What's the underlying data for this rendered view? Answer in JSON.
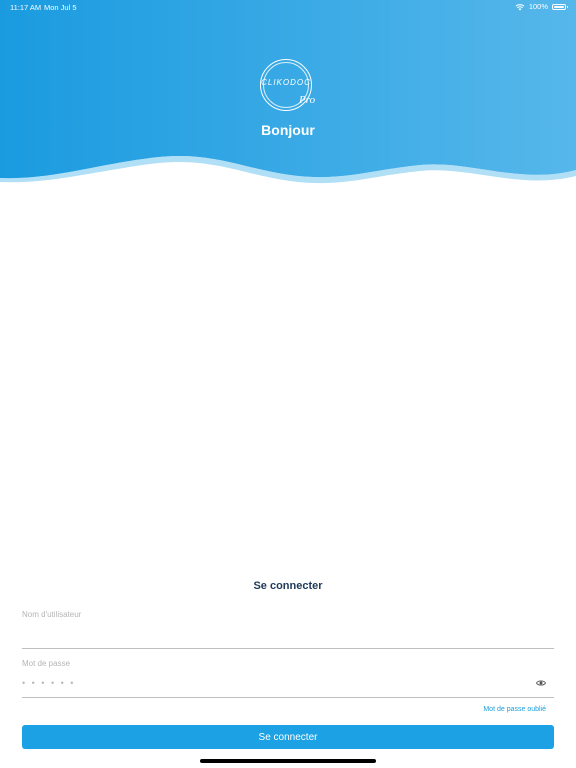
{
  "status_bar": {
    "time": "11:17 AM",
    "date": "Mon Jul 5",
    "battery": "100%"
  },
  "header": {
    "logo_text": "CLIKODOC",
    "logo_sub": "Pro",
    "greeting": "Bonjour"
  },
  "form": {
    "title": "Se connecter",
    "username_label": "Nom d'utilisateur",
    "username_value": "",
    "password_label": "Mot de passe",
    "password_placeholder": "• • • • • •",
    "forgot_password": "Mot de passe oublié",
    "submit_label": "Se connecter"
  },
  "colors": {
    "header_gradient_start": "#1a9be0",
    "header_gradient_end": "#56b7ea",
    "accent": "#1ba1e4",
    "title": "#1f3a5a"
  }
}
